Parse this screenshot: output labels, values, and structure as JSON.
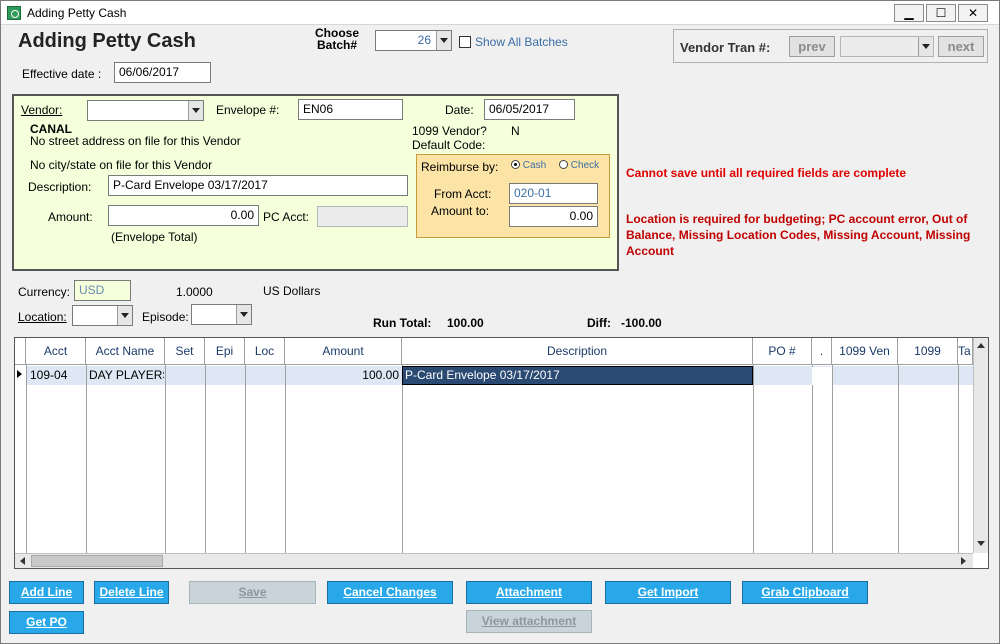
{
  "window": {
    "title": "Adding Petty Cash",
    "minimize": "▁",
    "maximize": "☐",
    "close": "✕"
  },
  "header": {
    "heading": "Adding Petty Cash",
    "choose_batch_label": "Choose\nBatch#",
    "batch_value": "26",
    "show_all_label": "Show All Batches",
    "effective_date_label": "Effective date :",
    "effective_date": "06/06/2017"
  },
  "vendor_tran": {
    "label": "Vendor Tran #:",
    "prev": "prev",
    "next": "next",
    "value": ""
  },
  "vendor": {
    "vendor_label": "Vendor:",
    "vendor_value": "",
    "envelope_label": "Envelope #:",
    "envelope_value": "EN06",
    "date_label": "Date:",
    "date_value": "06/05/2017",
    "vendor_name": "CANAL",
    "no_street": "No street address on file for this Vendor",
    "vendor_1099_label": "1099 Vendor?",
    "vendor_1099_value": "N",
    "default_code_label": "Default Code:",
    "no_city": "No city/state on file for this Vendor",
    "description_label": "Description:",
    "description_value": "P-Card Envelope 03/17/2017",
    "amount_label": "Amount:",
    "amount_value": "0.00",
    "pc_acct_label": "PC Acct:",
    "pc_acct_value": "",
    "envelope_total": "(Envelope Total)"
  },
  "reimburse": {
    "label": "Reimburse by:",
    "cash": "Cash",
    "check": "Check",
    "from_acct_label": "From Acct:",
    "from_acct_value": "020-01",
    "amount_to_label": "Amount to:",
    "amount_to_value": "0.00"
  },
  "errors": {
    "required": "Cannot save until all required fields are complete",
    "details": "Location is required for budgeting; PC account error, Out of Balance, Missing Location Codes, Missing Account, Missing Account"
  },
  "currency": {
    "label": "Currency:",
    "value": "USD",
    "rate": "1.0000",
    "name": "US Dollars",
    "location_label": "Location:",
    "episode_label": "Episode:"
  },
  "totals": {
    "run_total_label": "Run Total:",
    "run_total": "100.00",
    "diff_label": "Diff:",
    "diff": "-100.00"
  },
  "grid": {
    "columns": [
      "Acct",
      "Acct Name",
      "Set",
      "Epi",
      "Loc",
      "Amount",
      "Description",
      "PO #",
      ".",
      "1099 Ven",
      "1099",
      "Ta"
    ],
    "row": {
      "acct": "109-04",
      "acct_name": "DAY PLAYERS",
      "amount": "100.00",
      "description": "P-Card Envelope 03/17/2017"
    }
  },
  "buttons": {
    "add_line": "Add Line",
    "delete_line": "Delete Line",
    "save": "Save",
    "cancel_changes": "Cancel Changes",
    "attachment": "Attachment",
    "get_import": "Get Import",
    "grab_clipboard": "Grab Clipboard",
    "get_po": "Get PO",
    "view_attachment": "View attachment"
  }
}
